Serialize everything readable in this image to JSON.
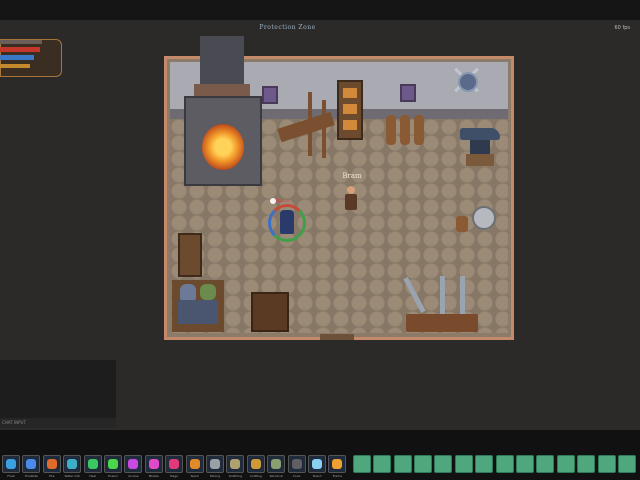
{
  "header": {
    "zone": "Protection Zone",
    "fps": "60 fps"
  },
  "hud": {
    "level_text": "",
    "health_text": "",
    "mana_text": "",
    "xp_text": ""
  },
  "scene": {
    "npc_name": "Bram",
    "player_name": "Jesus",
    "colors": {
      "wall": "#a9aab2",
      "floor": "#877766",
      "wood": "#6b4a2e",
      "fire": "#f39a2a",
      "empty_slot": "#4fa77e"
    }
  },
  "chat": {
    "input_label": "CHAT INPUT"
  },
  "hotbar": {
    "skills": [
      {
        "icon": "ice-bolt-icon",
        "color": "#3aa0e0",
        "label": "Frost"
      },
      {
        "icon": "frost-nova-icon",
        "color": "#4a8ae8",
        "label": "Frostbite"
      },
      {
        "icon": "fireball-icon",
        "color": "#e06a2a",
        "label": "Fire"
      },
      {
        "icon": "water-orb-icon",
        "color": "#3ab0c8",
        "label": "Water Orb"
      },
      {
        "icon": "heal-icon",
        "color": "#3ac860",
        "label": "Heal"
      },
      {
        "icon": "poison-icon",
        "color": "#4ad84a",
        "label": "Poison"
      },
      {
        "icon": "arcane-icon",
        "color": "#c84ae0",
        "label": "Arcane"
      },
      {
        "icon": "magic-missile-icon",
        "color": "#e04ac8",
        "label": "Missile"
      },
      {
        "icon": "rage-icon",
        "color": "#e03a7a",
        "label": "Rage"
      },
      {
        "icon": "slash-icon",
        "color": "#e08a2a",
        "label": "Slash"
      },
      {
        "icon": "pickaxe-icon",
        "color": "#9aa0a8",
        "label": "Mining"
      },
      {
        "icon": "hammer-icon",
        "color": "#b0a070",
        "label": "Smithing"
      },
      {
        "icon": "craft-icon",
        "color": "#d09a3a",
        "label": "Crafting"
      },
      {
        "icon": "axe-icon",
        "color": "#8aa070",
        "label": "Woodcut"
      },
      {
        "icon": "cook-pot-icon",
        "color": "#606060",
        "label": "Cook"
      },
      {
        "icon": "ice-shard-icon",
        "color": "#8ad0f0",
        "label": "Shard"
      },
      {
        "icon": "flame-icon",
        "color": "#f0a030",
        "label": "Flame"
      }
    ],
    "empty_slots": 15
  }
}
